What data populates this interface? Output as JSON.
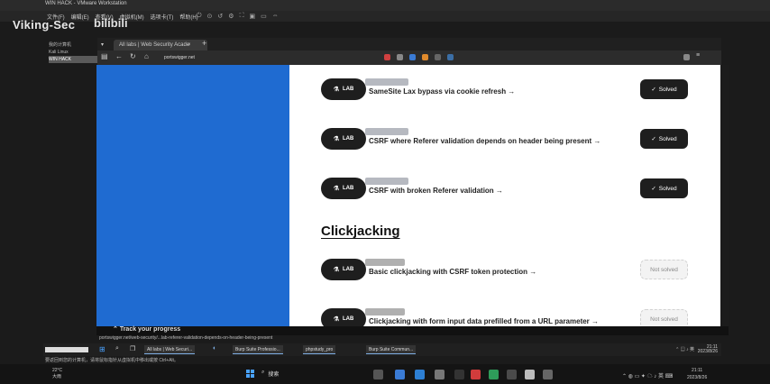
{
  "vm": {
    "title": "WIN HACK - VMware Workstation",
    "menus": [
      "文件(F)",
      "编辑(E)",
      "查看(V)",
      "虚拟机(M)",
      "选项卡(T)",
      "帮助(H)"
    ],
    "library": [
      "我的计算机",
      "Kali Linux",
      "WIN HACK"
    ],
    "hint": "要返回到您的计算机，请将鼠标指针从虚拟机中移出或按 Ctrl+Alt。"
  },
  "watermark": {
    "text": "Viking-Sec",
    "logo": "bilibili"
  },
  "browser": {
    "tab_title": "All labs | Web Security Acade",
    "tab_close": "×",
    "new_tab": "+",
    "url": "portswigger.net",
    "status_url": "portswigger.net/web-security/...lab-referer-validation-depends-on-header-being-present"
  },
  "page": {
    "section_heading": "Clickjacking",
    "track_text": "Track your progress",
    "labs": [
      {
        "badge": "LAB",
        "title": "SameSite Lax bypass via cookie refresh →",
        "status": "Solved",
        "solved": true
      },
      {
        "badge": "LAB",
        "title": "CSRF where Referer validation depends on header being present →",
        "status": "Solved",
        "solved": true
      },
      {
        "badge": "LAB",
        "title": "CSRF with broken Referer validation →",
        "status": "Solved",
        "solved": true
      },
      {
        "badge": "LAB",
        "title": "Basic clickjacking with CSRF token protection →",
        "status": "Not solved",
        "solved": false
      },
      {
        "badge": "LAB",
        "title": "Clickjacking with form input data prefilled from a URL parameter →",
        "status": "Not solved",
        "solved": false
      }
    ]
  },
  "vm_taskbar": {
    "items": [
      "All labs | Web Securi...",
      "Burp Suite Professio...",
      "phpstudy_pro",
      "Burp Suite Commun..."
    ],
    "clock_time": "21:11",
    "clock_date": "2023/8/26"
  },
  "host_taskbar": {
    "weather_temp": "22°C",
    "weather_desc": "大雨",
    "search_label": "搜索",
    "clock_time": "21:11",
    "clock_date": "2023/8/26"
  },
  "colors": {
    "left_panel": "#1f6bd1",
    "solved_bg": "#1e1e1e",
    "content_bg": "#ffffff"
  }
}
